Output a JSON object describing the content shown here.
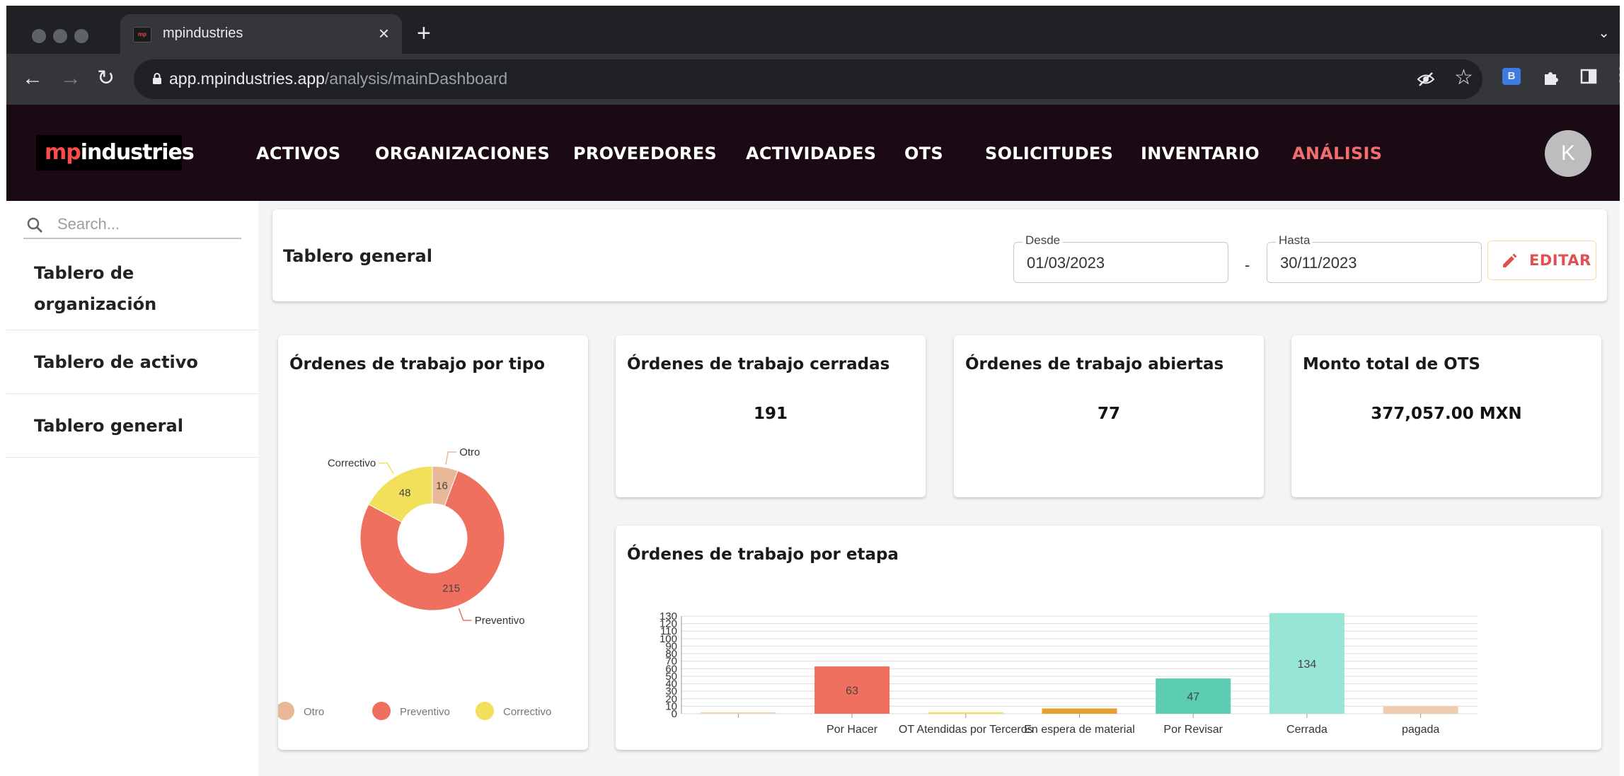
{
  "browser": {
    "tab_title": "mpindustries",
    "url_host": "app.mpindustries.app",
    "url_path": "/analysis/mainDashboard"
  },
  "app": {
    "logo_prefix": "mp",
    "logo_suffix": "industries",
    "menu": [
      {
        "label": "ACTIVOS",
        "active": false
      },
      {
        "label": "ORGANIZACIONES",
        "active": false
      },
      {
        "label": "PROVEEDORES",
        "active": false
      },
      {
        "label": "ACTIVIDADES",
        "active": false
      },
      {
        "label": "OTS",
        "active": false
      },
      {
        "label": "SOLICITUDES",
        "active": false
      },
      {
        "label": "INVENTARIO",
        "active": false
      },
      {
        "label": "ANÁLISIS",
        "active": true
      }
    ],
    "avatar_initial": "K",
    "accent_color": "#f26d6d",
    "header_bg": "#1b0a14"
  },
  "sidebar": {
    "search_placeholder": "Search...",
    "items": [
      {
        "label_line1": "Tablero de",
        "label_line2": "organización"
      },
      {
        "label": "Tablero de activo"
      },
      {
        "label": "Tablero general"
      }
    ]
  },
  "dashboard": {
    "title": "Tablero general",
    "desde_label": "Desde",
    "desde_value": "01/03/2023",
    "separator": "-",
    "hasta_label": "Hasta",
    "hasta_value": "30/11/2023",
    "edit_label": "EDITAR"
  },
  "kpis": [
    {
      "title": "Órdenes de trabajo cerradas",
      "value": "191"
    },
    {
      "title": "Órdenes de trabajo abiertas",
      "value": "77"
    },
    {
      "title": "Monto total de OTS",
      "value": "377,057.00 MXN"
    }
  ],
  "chart_data": [
    {
      "type": "pie",
      "title": "Órdenes de trabajo por tipo",
      "donut": true,
      "legend_position": "bottom",
      "slices": [
        {
          "name": "Otro",
          "value": 16,
          "color": "#e8b898"
        },
        {
          "name": "Preventivo",
          "value": 215,
          "color": "#f07060"
        },
        {
          "name": "Correctivo",
          "value": 48,
          "color": "#f2e05a"
        }
      ]
    },
    {
      "type": "bar",
      "title": "Órdenes de trabajo por etapa",
      "categories": [
        "",
        "Por Hacer",
        "OT Atendidas por Terceros",
        "En espera de material",
        "Por Revisar",
        "Cerrada",
        "pagada"
      ],
      "values": [
        2,
        63,
        2,
        7,
        47,
        134,
        10
      ],
      "data_labels": [
        "",
        "63",
        "",
        "",
        "47",
        "134",
        ""
      ],
      "colors": [
        "#f1d3b8",
        "#f07060",
        "#f2e05a",
        "#e6a030",
        "#5ccdb2",
        "#97e5d5",
        "#efcdb0"
      ],
      "yticks": [
        0,
        10,
        20,
        30,
        40,
        50,
        60,
        70,
        80,
        90,
        100,
        110,
        120,
        130
      ],
      "ylim": [
        0,
        130
      ],
      "grid": true
    }
  ]
}
